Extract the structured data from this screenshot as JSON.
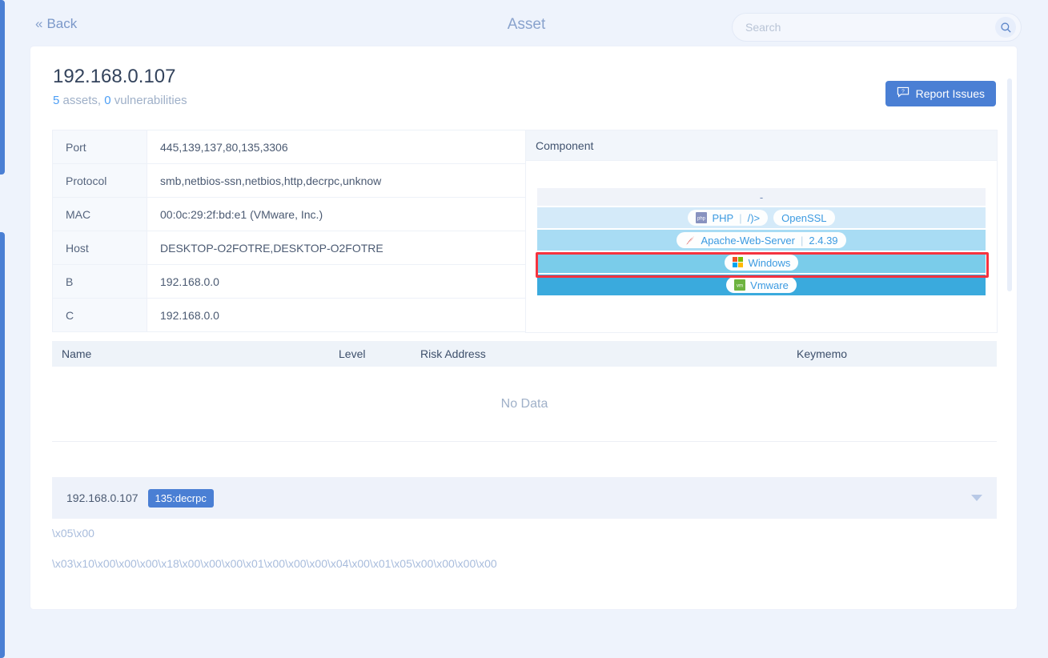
{
  "header": {
    "back_label": "Back",
    "back_icon": "double-chevron-left-icon",
    "title": "Asset",
    "search": {
      "placeholder": "Search",
      "value": "",
      "icon": "search-icon"
    }
  },
  "asset": {
    "ip": "192.168.0.107",
    "summary_assets": "5",
    "summary_assets_label": " assets, ",
    "summary_vulns": "0",
    "summary_vulns_label": " vulnerabilities",
    "report_button": {
      "label": "Report Issues",
      "icon": "question-speech-bubble-icon"
    }
  },
  "info_table": {
    "rows": [
      {
        "key": "Port",
        "value": "445,139,137,80,135,3306"
      },
      {
        "key": "Protocol",
        "value": "smb,netbios-ssn,netbios,http,decrpc,unknow"
      },
      {
        "key": "MAC",
        "value": "00:0c:29:2f:bd:e1 (VMware, Inc.)"
      },
      {
        "key": "Host",
        "value": "DESKTOP-O2FOTRE,DESKTOP-O2FOTRE"
      },
      {
        "key": "B",
        "value": "192.168.0.0"
      },
      {
        "key": "C",
        "value": "192.168.0.0"
      }
    ]
  },
  "component": {
    "title": "Component",
    "placeholder_dash": "-",
    "highlight_color": "#f5333f",
    "layers": [
      {
        "color": "#f0f3f9",
        "pills": []
      },
      {
        "color": "#d4eaf9",
        "highlighted": true,
        "pills": [
          {
            "icon": "php-icon",
            "name": "PHP",
            "version": "/)>"
          },
          {
            "icon": "",
            "name": "OpenSSL",
            "version": ""
          }
        ]
      },
      {
        "color": "#a8dcf4",
        "pills": [
          {
            "icon": "apache-feather-icon",
            "name": "Apache-Web-Server",
            "version": "2.4.39"
          }
        ]
      },
      {
        "color": "#7accea",
        "pills": [
          {
            "icon": "windows-icon",
            "name": "Windows",
            "version": ""
          }
        ]
      },
      {
        "color": "#3aaadd",
        "pills": [
          {
            "icon": "vmware-icon",
            "name": "Vmware",
            "version": ""
          }
        ]
      }
    ]
  },
  "risk_table": {
    "columns": [
      "Name",
      "Level",
      "Risk Address",
      "Keymemo"
    ],
    "empty_text": "No Data",
    "rows": []
  },
  "accordion": {
    "ip": "192.168.0.107",
    "tag": "135:decrpc",
    "caret_icon": "chevron-down-icon",
    "lines": [
      "\\x05\\x00",
      "\\x03\\x10\\x00\\x00\\x00\\x18\\x00\\x00\\x00\\x01\\x00\\x00\\x00\\x04\\x00\\x01\\x05\\x00\\x00\\x00\\x00"
    ]
  }
}
